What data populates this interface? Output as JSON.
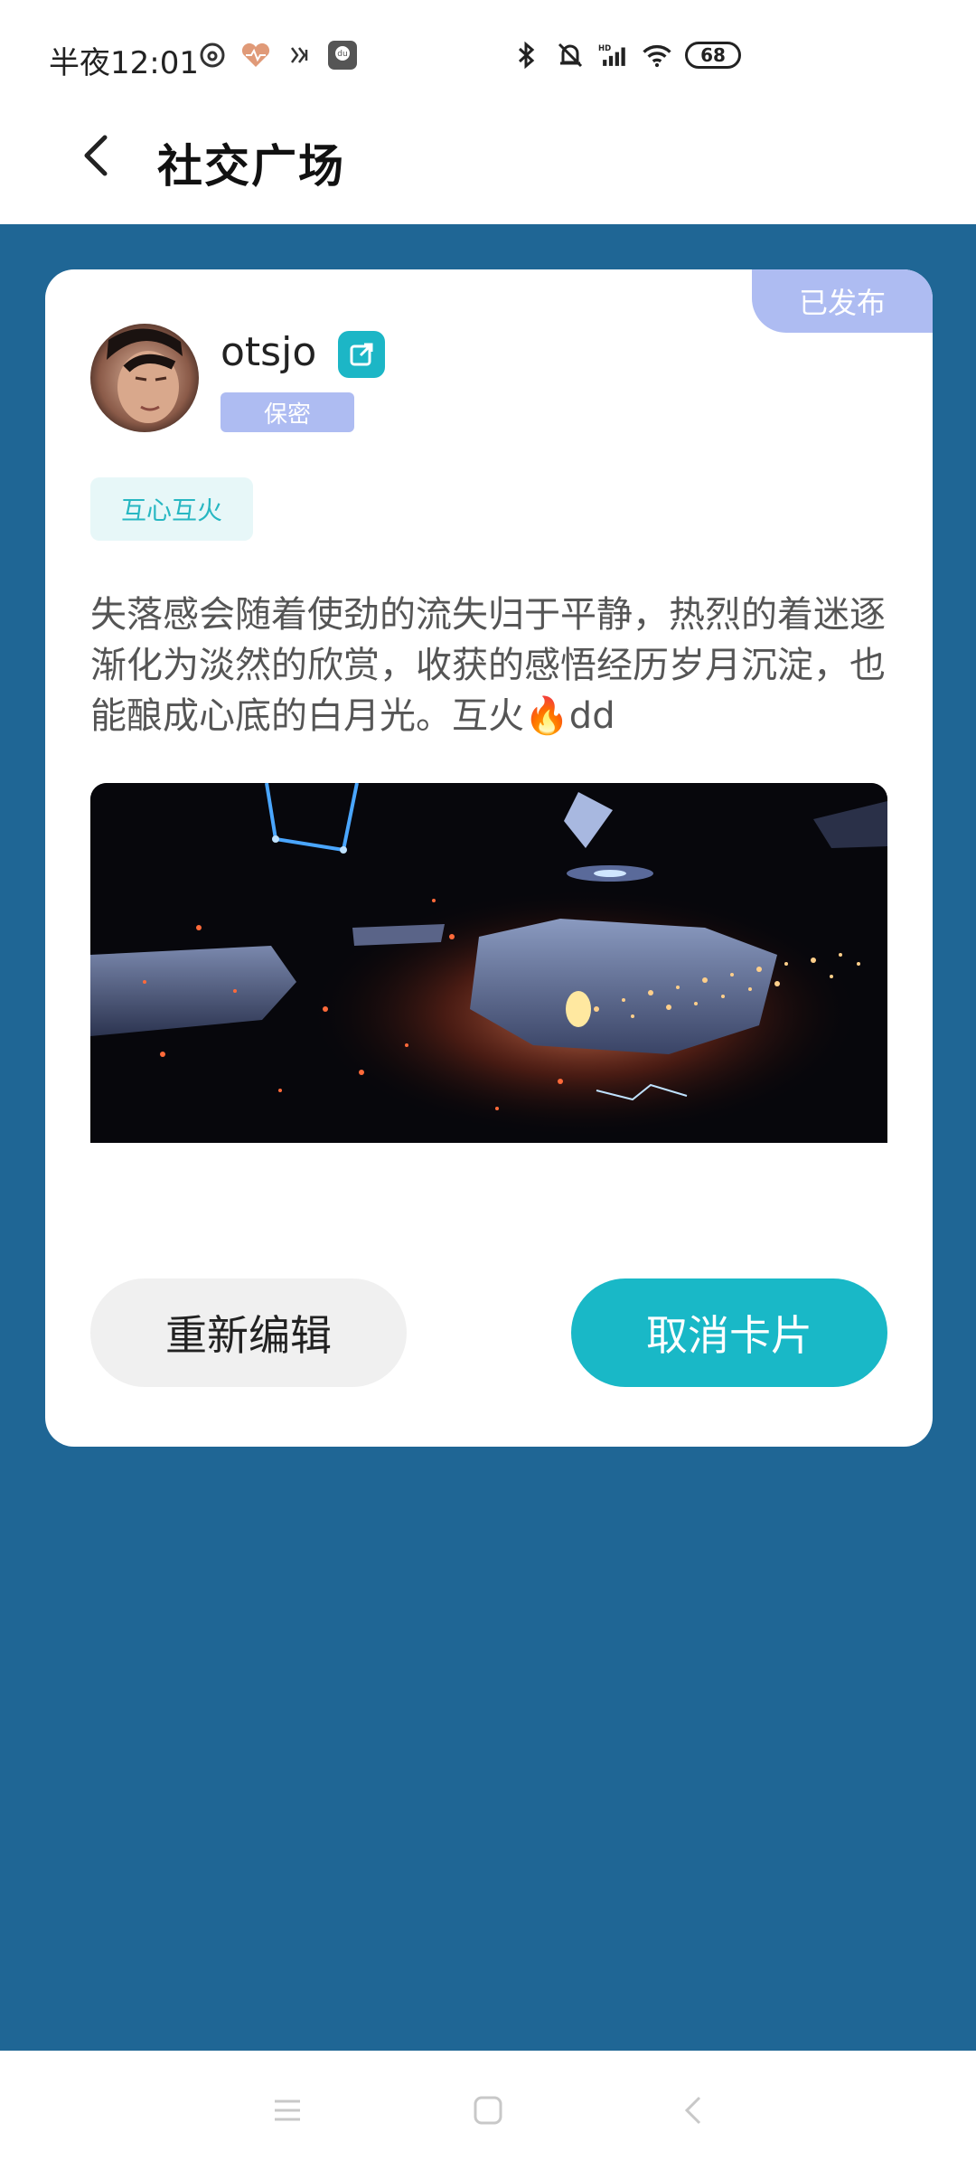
{
  "status_bar": {
    "time": "半夜12:01",
    "battery": "68",
    "left_icons": [
      "netease-music-icon",
      "health-heart-icon",
      "app-icon",
      "du-app-icon"
    ],
    "right_icons": [
      "bluetooth-icon",
      "mute-bell-icon",
      "hd-signal-icon",
      "wifi-icon",
      "battery-icon"
    ]
  },
  "header": {
    "title": "社交广场",
    "back_icon": "chevron-left-icon"
  },
  "card": {
    "status_badge": "已发布",
    "user": {
      "name": "otsjo",
      "privacy": "保密",
      "share_icon": "external-link-icon"
    },
    "tag": "互心互火",
    "text": "失落感会随着使劲的流失归于平静，热烈的着迷逐渐化为淡然的欣赏，收获的感悟经历岁月沉淀，也能酿成心底的白月光。互火🔥dd",
    "edit_button": "重新编辑",
    "cancel_button": "取消卡片"
  },
  "colors": {
    "page_bg": "#1f6695",
    "accent": "#19b8c7",
    "badge": "#aebcf2"
  },
  "nav_bar": {
    "icons": [
      "menu-icon",
      "home-icon",
      "back-icon"
    ]
  }
}
